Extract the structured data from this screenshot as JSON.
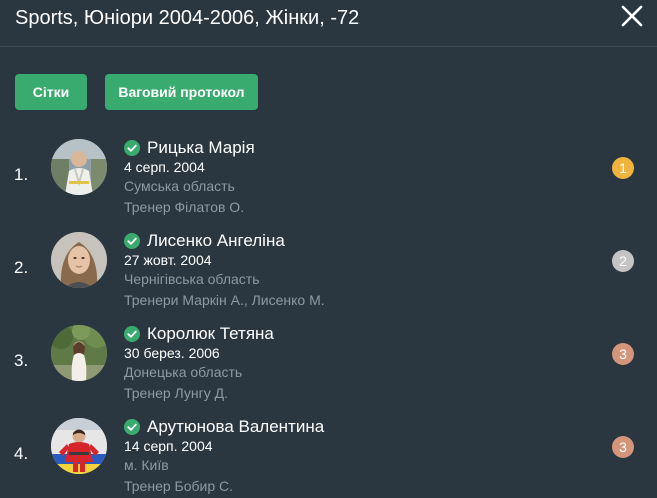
{
  "header": {
    "title": "Sports, Юніори 2004-2006, Жінки, -72"
  },
  "buttons": {
    "grids": "Сітки",
    "weigh_protocol": "Ваговий протокол"
  },
  "colors": {
    "background": "#2a3741",
    "button": "#3aab6e",
    "check": "#3aab6e",
    "muted_text": "#8d99a3",
    "medal_gold": "#f0b43c",
    "medal_silver": "#c4c4c4",
    "medal_bronze": "#d4957a"
  },
  "athletes": [
    {
      "rank": "1.",
      "name": "Рицька Марія",
      "dob": "4 серп. 2004",
      "region": "Сумська область",
      "coach": "Тренер Філатов О.",
      "place": "1",
      "medal_color": "#f0b43c",
      "avatar": "judo-athlete-photo"
    },
    {
      "rank": "2.",
      "name": "Лисенко Ангеліна",
      "dob": "27 жовт. 2004",
      "region": "Чернігівська область",
      "coach": "Тренери Маркін А.,  Лисенко М.",
      "place": "2",
      "medal_color": "#c4c4c4",
      "avatar": "portrait-photo"
    },
    {
      "rank": "3.",
      "name": "Королюк Тетяна",
      "dob": "30 берез. 2006",
      "region": "Донецька область",
      "coach": "Тренер Лунгу Д.",
      "place": "3",
      "medal_color": "#d4957a",
      "avatar": "outdoor-portrait-photo"
    },
    {
      "rank": "4.",
      "name": "Арутюнова Валентина",
      "dob": "14 серп. 2004",
      "region": "м. Київ",
      "coach": "Тренер Бобир С.",
      "place": "3",
      "medal_color": "#d4957a",
      "avatar": "sambo-athlete-photo"
    }
  ]
}
